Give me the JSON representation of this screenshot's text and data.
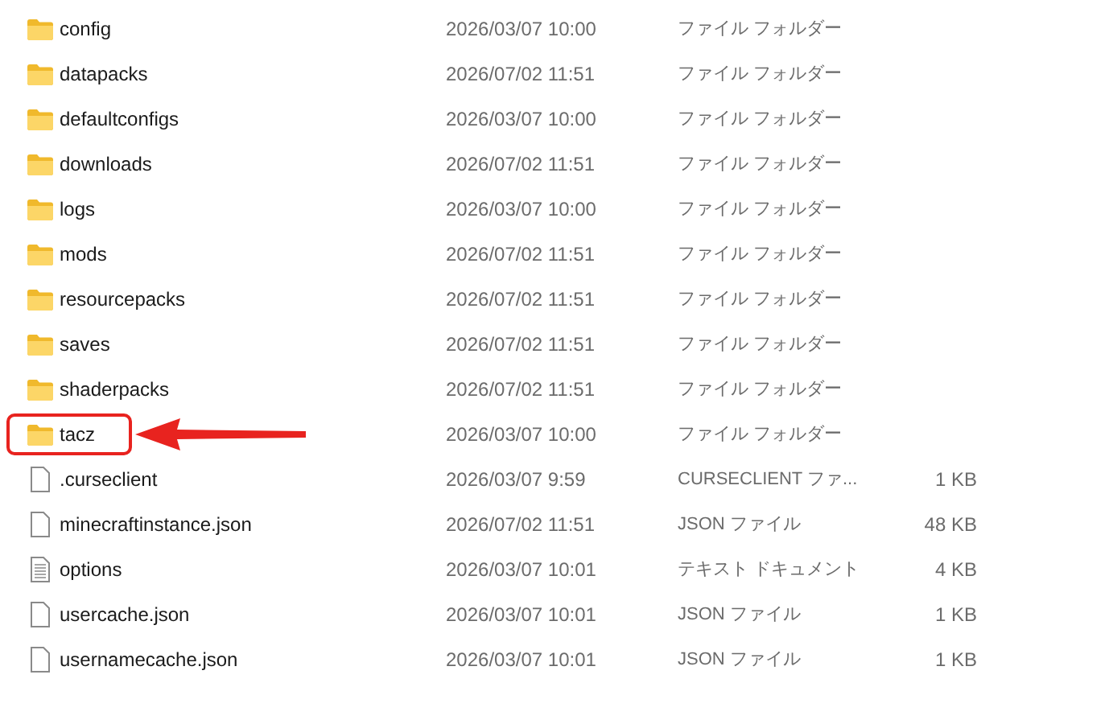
{
  "files": [
    {
      "kind": "folder",
      "name": "config",
      "date": "2026/03/07 10:00",
      "type": "ファイル フォルダー",
      "highlighted": false
    },
    {
      "kind": "folder",
      "name": "datapacks",
      "date": "2026/07/02 11:51",
      "type": "ファイル フォルダー",
      "highlighted": false
    },
    {
      "kind": "folder",
      "name": "defaultconfigs",
      "date": "2026/03/07 10:00",
      "type": "ファイル フォルダー",
      "highlighted": false
    },
    {
      "kind": "folder",
      "name": "downloads",
      "date": "2026/07/02 11:51",
      "type": "ファイル フォルダー",
      "highlighted": false
    },
    {
      "kind": "folder",
      "name": "logs",
      "date": "2026/03/07 10:00",
      "type": "ファイル フォルダー",
      "highlighted": false
    },
    {
      "kind": "folder",
      "name": "mods",
      "date": "2026/07/02 11:51",
      "type": "ファイル フォルダー",
      "highlighted": false
    },
    {
      "kind": "folder",
      "name": "resourcepacks",
      "date": "2026/07/02 11:51",
      "type": "ファイル フォルダー",
      "highlighted": false
    },
    {
      "kind": "folder",
      "name": "saves",
      "date": "2026/07/02 11:51",
      "type": "ファイル フォルダー",
      "highlighted": false
    },
    {
      "kind": "folder",
      "name": "shaderpacks",
      "date": "2026/07/02 11:51",
      "type": "ファイル フォルダー",
      "highlighted": false
    },
    {
      "kind": "folder",
      "name": "tacz",
      "date": "2026/03/07 10:00",
      "type": "ファイル フォルダー",
      "highlighted": true
    },
    {
      "kind": "file",
      "name": ".curseclient",
      "date": "2026/03/07 9:59",
      "type": "CURSECLIENT ファ...",
      "size": "1 KB",
      "highlighted": false
    },
    {
      "kind": "file",
      "name": "minecraftinstance.json",
      "date": "2026/07/02 11:51",
      "type": "JSON ファイル",
      "size": "48 KB",
      "highlighted": false
    },
    {
      "kind": "text",
      "name": "options",
      "date": "2026/03/07 10:01",
      "type": "テキスト ドキュメント",
      "size": "4 KB",
      "highlighted": false
    },
    {
      "kind": "file",
      "name": "usercache.json",
      "date": "2026/03/07 10:01",
      "type": "JSON ファイル",
      "size": "1 KB",
      "highlighted": false
    },
    {
      "kind": "file",
      "name": "usernamecache.json",
      "date": "2026/03/07 10:01",
      "type": "JSON ファイル",
      "size": "1 KB",
      "highlighted": false
    }
  ]
}
